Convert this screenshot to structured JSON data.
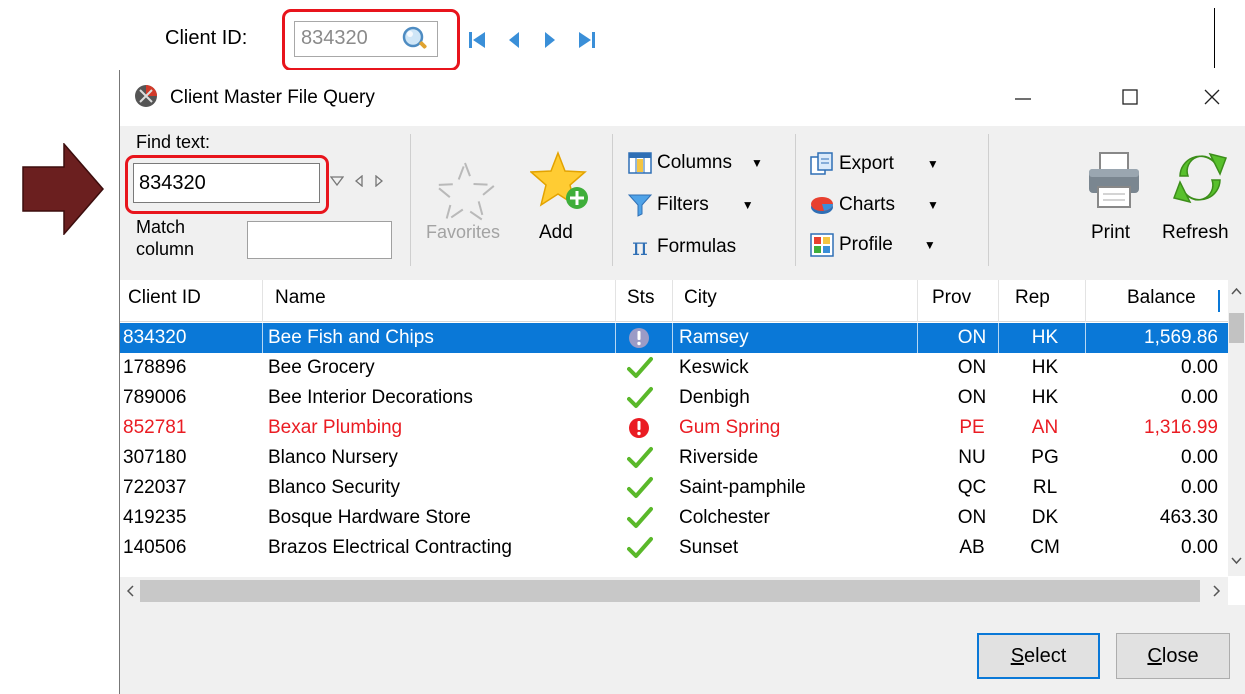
{
  "top_bar": {
    "client_id_label": "Client ID:",
    "client_id_value": "834320"
  },
  "dialog": {
    "title": "Client Master File Query",
    "find_text_label": "Find text:",
    "find_text_value": "834320",
    "match_column_label": "Match column",
    "match_column_value": "",
    "favorites_label": "Favorites",
    "add_label": "Add",
    "columns_label": "Columns",
    "filters_label": "Filters",
    "formulas_label": "Formulas",
    "export_label": "Export",
    "charts_label": "Charts",
    "profile_label": "Profile",
    "print_label": "Print",
    "refresh_label": "Refresh",
    "select_button": "Select",
    "close_button": "Close"
  },
  "grid": {
    "headers": [
      "Client ID",
      "Name",
      "Sts",
      "City",
      "Prov",
      "Rep",
      "Balance"
    ],
    "rows": [
      {
        "id": "834320",
        "name": "Bee Fish and Chips",
        "sts": "alert",
        "city": "Ramsey",
        "prov": "ON",
        "rep": "HK",
        "balance": "1,569.86",
        "state": "selected"
      },
      {
        "id": "178896",
        "name": "Bee Grocery",
        "sts": "ok",
        "city": "Keswick",
        "prov": "ON",
        "rep": "HK",
        "balance": "0.00",
        "state": "normal"
      },
      {
        "id": "789006",
        "name": "Bee Interior Decorations",
        "sts": "ok",
        "city": "Denbigh",
        "prov": "ON",
        "rep": "HK",
        "balance": "0.00",
        "state": "normal"
      },
      {
        "id": "852781",
        "name": "Bexar Plumbing",
        "sts": "alert",
        "city": "Gum Spring",
        "prov": "PE",
        "rep": "AN",
        "balance": "1,316.99",
        "state": "red"
      },
      {
        "id": "307180",
        "name": "Blanco Nursery",
        "sts": "ok",
        "city": "Riverside",
        "prov": "NU",
        "rep": "PG",
        "balance": "0.00",
        "state": "normal"
      },
      {
        "id": "722037",
        "name": "Blanco Security",
        "sts": "ok",
        "city": "Saint-pamphile",
        "prov": "QC",
        "rep": "RL",
        "balance": "0.00",
        "state": "normal"
      },
      {
        "id": "419235",
        "name": "Bosque Hardware Store",
        "sts": "ok",
        "city": "Colchester",
        "prov": "ON",
        "rep": "DK",
        "balance": "463.30",
        "state": "normal"
      },
      {
        "id": "140506",
        "name": "Brazos Electrical Contracting",
        "sts": "ok",
        "city": "Sunset",
        "prov": "AB",
        "rep": "CM",
        "balance": "0.00",
        "state": "normal"
      }
    ]
  },
  "colors": {
    "selection": "#0a78d7",
    "alert_red": "#ea1c23",
    "highlight_outline": "#e8141c",
    "arrow": "#6b1f1f",
    "ok_green": "#5ab82a"
  }
}
